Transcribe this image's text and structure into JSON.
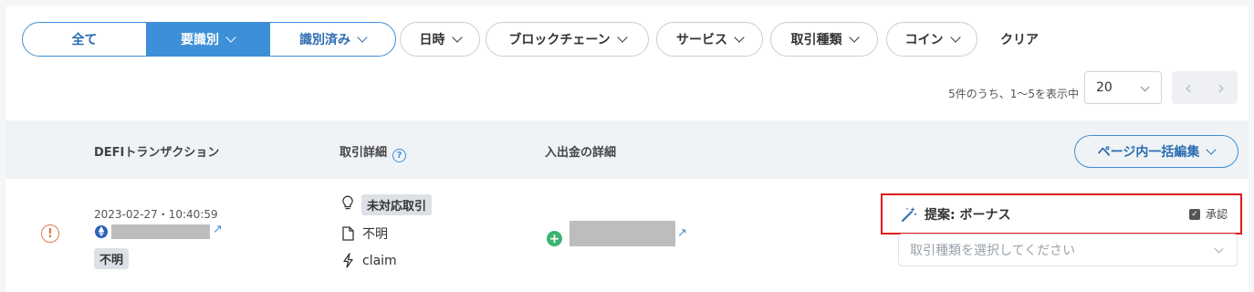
{
  "filters": {
    "segments": [
      "全て",
      "要識別",
      "識別済み"
    ],
    "pills": [
      "日時",
      "ブロックチェーン",
      "サービス",
      "取引種類",
      "コイン"
    ],
    "clear_label": "クリア"
  },
  "pagination": {
    "summary": "5件のうち、1〜5を表示中",
    "page_size": "20",
    "prev_icon": "chevron-left-icon",
    "next_icon": "chevron-right-icon"
  },
  "table": {
    "headers": {
      "transaction": "DEFIトランザクション",
      "detail": "取引詳細",
      "inout": "入出金の詳細"
    },
    "bulk_edit_label": "ページ内一括編集"
  },
  "row": {
    "status_icon": "warning-circle-icon",
    "datetime": "2023-02-27・10:40:59",
    "chain_tag": "不明",
    "detail_unsupported": "未対応取引",
    "detail_type": "不明",
    "detail_action": "claim",
    "suggestion_label": "提案: ボーナス",
    "approve_label": "承認",
    "type_placeholder": "取引種類を選択してください"
  },
  "colors": {
    "accent": "#3d8fd8",
    "highlight_border": "#e11b1b",
    "warning": "#e07a4b",
    "incoming": "#3cb371"
  }
}
